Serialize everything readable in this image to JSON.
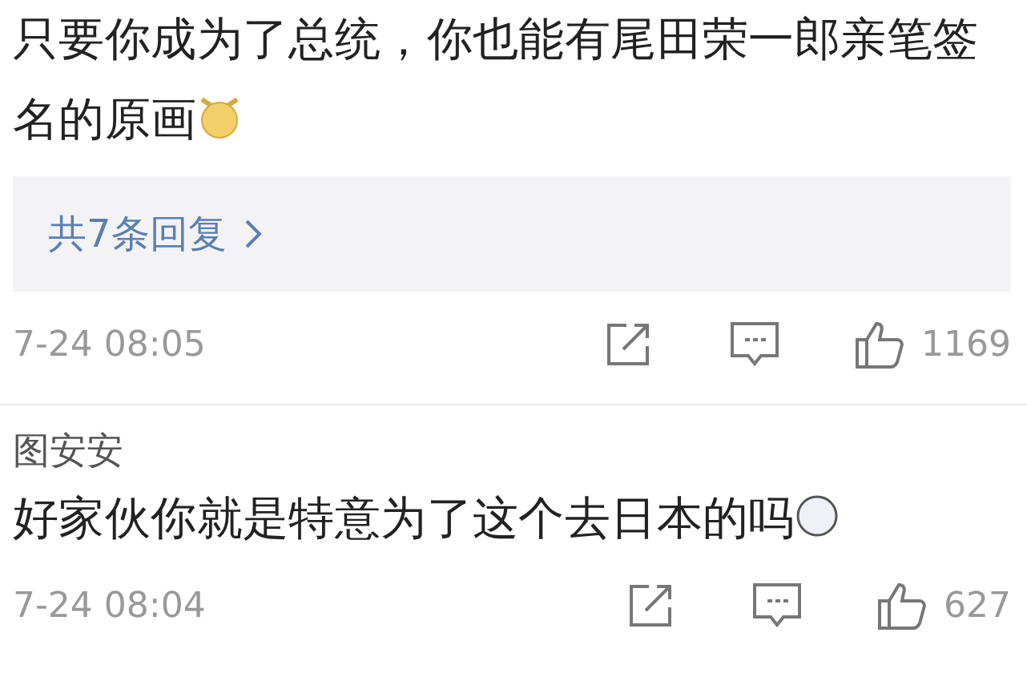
{
  "comments": [
    {
      "text": "只要你成为了总统，你也能有尾田荣一郎亲笔签名的原画",
      "replies": "共7条回复",
      "time": "7-24 08:05",
      "likes": "1169"
    },
    {
      "author": "图安安",
      "text": "好家伙你就是特意为了这个去日本的吗",
      "time": "7-24 08:04",
      "likes": "627"
    }
  ]
}
